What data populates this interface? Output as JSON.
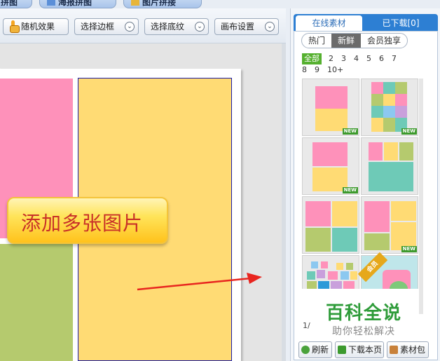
{
  "top_tabs": [
    "拼图",
    "海报拼图",
    "图片拼接"
  ],
  "toolbar": {
    "random": "随机效果",
    "border": "选择边框",
    "texture": "选择底纹",
    "canvas": "画布设置"
  },
  "canvas": {
    "callout_text": "添加多张图片"
  },
  "panel": {
    "tab_online": "在线素材",
    "tab_downloaded": "已下载[0]",
    "filters": [
      "热门",
      "新鲜",
      "会员独享"
    ],
    "active_filter": "新鲜",
    "count_all": "全部",
    "counts": [
      "2",
      "3",
      "4",
      "5",
      "6",
      "7",
      "8",
      "9",
      "10+"
    ],
    "new_badge": "NEW",
    "member_badge": "会员",
    "pager": "1/",
    "buttons": {
      "refresh": "刷新",
      "download_page": "下载本页",
      "material_pack": "素材包"
    }
  },
  "watermark": {
    "title": "百科全说",
    "subtitle": "助你轻松解决"
  },
  "colors": {
    "pink": "#fe91ba",
    "yellow": "#ffdb74",
    "green": "#b5ca6e",
    "teal": "#6ecab7",
    "accent_blue": "#2d7fd3",
    "callout_text": "#c83028",
    "arrow_red": "#e8251f"
  }
}
